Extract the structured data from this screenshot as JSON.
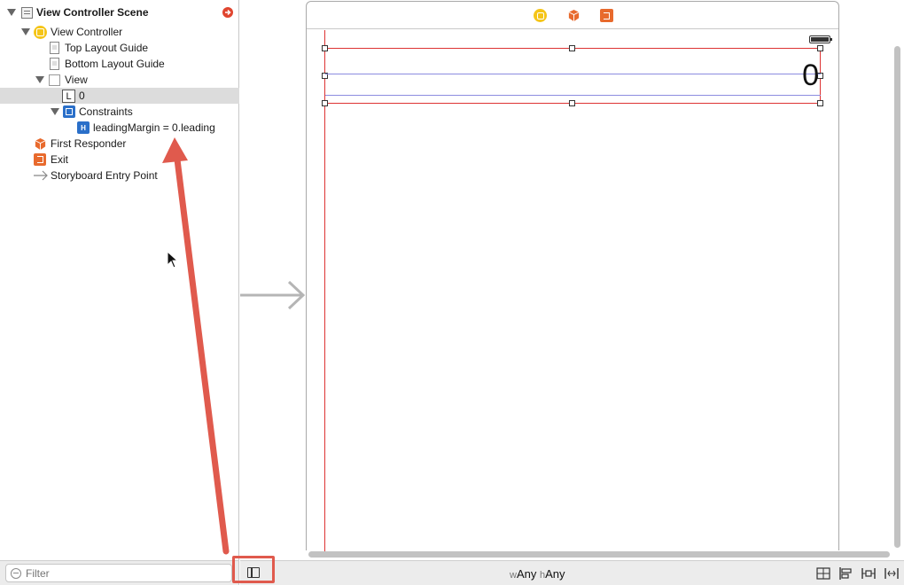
{
  "outline": {
    "items": [
      {
        "label": "View Controller Scene",
        "icon": "storyboard-scene-icon"
      },
      {
        "label": "View Controller",
        "icon": "view-controller-icon"
      },
      {
        "label": "Top Layout Guide",
        "icon": "layout-guide-icon"
      },
      {
        "label": "Bottom Layout Guide",
        "icon": "layout-guide-icon"
      },
      {
        "label": "View",
        "icon": "view-icon"
      },
      {
        "label": "0",
        "icon": "label-icon",
        "icon_text": "L"
      },
      {
        "label": "Constraints",
        "icon": "constraints-icon"
      },
      {
        "label": "leadingMargin = 0.leading",
        "icon": "constraint-icon",
        "icon_text": "H"
      },
      {
        "label": "First Responder",
        "icon": "first-responder-icon"
      },
      {
        "label": "Exit",
        "icon": "exit-icon"
      },
      {
        "label": "Storyboard Entry Point",
        "icon": "entry-point-arrow-icon"
      }
    ]
  },
  "filter": {
    "placeholder": "Filter"
  },
  "canvas": {
    "label_text": "0"
  },
  "bottombar": {
    "size_class": {
      "w_prefix": "w",
      "w_value": "Any",
      "h_prefix": "h",
      "h_value": "Any"
    }
  },
  "colors": {
    "selection_red": "#d33333",
    "guide_blue": "#8c8ce0",
    "annotation_red": "#e05a4d",
    "vc_yellow": "#f5c518",
    "exit_orange": "#e86a2d",
    "constraint_blue": "#2a6fc9"
  }
}
